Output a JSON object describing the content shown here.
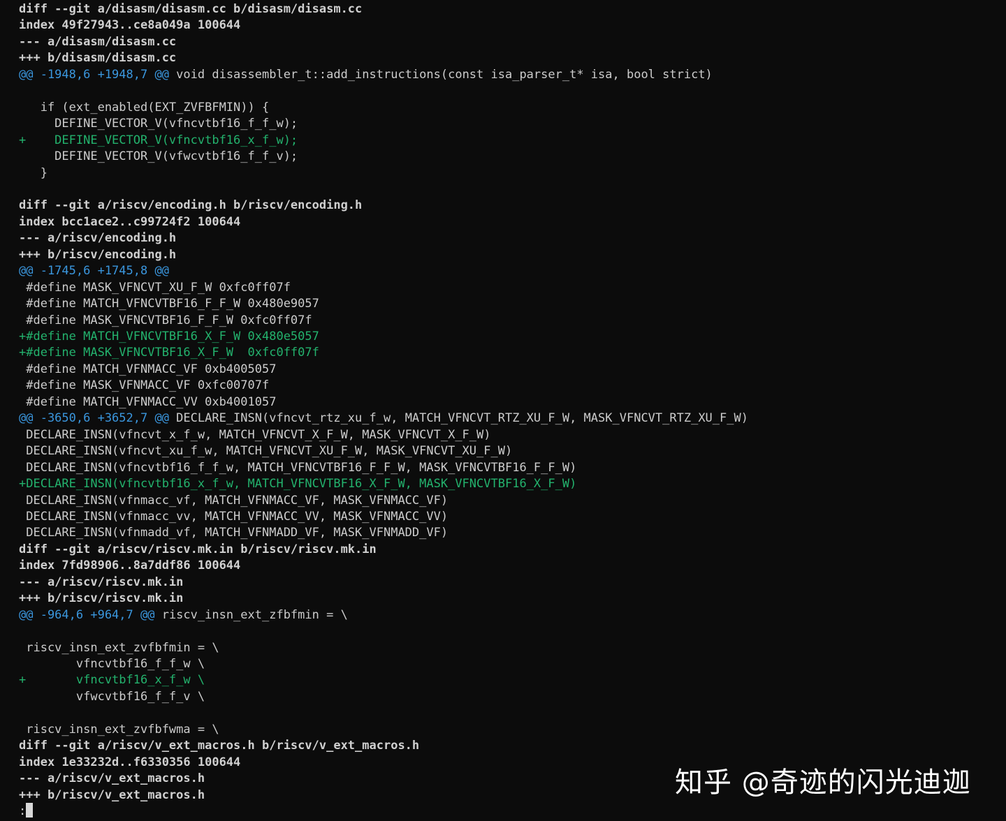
{
  "terminal": {
    "lines": [
      {
        "kind": "meta",
        "text": "diff --git a/disasm/disasm.cc b/disasm/disasm.cc"
      },
      {
        "kind": "meta",
        "text": "index 49f27943..ce8a049a 100644"
      },
      {
        "kind": "meta",
        "text": "--- a/disasm/disasm.cc"
      },
      {
        "kind": "meta",
        "text": "+++ b/disasm/disasm.cc"
      },
      {
        "kind": "hunk",
        "marker": "@@ -1948,6 +1948,7 @@",
        "text": " void disassembler_t::add_instructions(const isa_parser_t* isa, bool strict)"
      },
      {
        "kind": "ctx",
        "text": ""
      },
      {
        "kind": "ctx",
        "text": "   if (ext_enabled(EXT_ZVFBFMIN)) {"
      },
      {
        "kind": "ctx",
        "text": "     DEFINE_VECTOR_V(vfncvtbf16_f_f_w);"
      },
      {
        "kind": "add",
        "text": "+    DEFINE_VECTOR_V(vfncvtbf16_x_f_w);"
      },
      {
        "kind": "ctx",
        "text": "     DEFINE_VECTOR_V(vfwcvtbf16_f_f_v);"
      },
      {
        "kind": "ctx",
        "text": "   }"
      },
      {
        "kind": "ctx",
        "text": ""
      },
      {
        "kind": "meta",
        "text": "diff --git a/riscv/encoding.h b/riscv/encoding.h"
      },
      {
        "kind": "meta",
        "text": "index bcc1ace2..c99724f2 100644"
      },
      {
        "kind": "meta",
        "text": "--- a/riscv/encoding.h"
      },
      {
        "kind": "meta",
        "text": "+++ b/riscv/encoding.h"
      },
      {
        "kind": "hunk",
        "marker": "@@ -1745,6 +1745,8 @@",
        "text": ""
      },
      {
        "kind": "ctx",
        "text": " #define MASK_VFNCVT_XU_F_W 0xfc0ff07f"
      },
      {
        "kind": "ctx",
        "text": " #define MATCH_VFNCVTBF16_F_F_W 0x480e9057"
      },
      {
        "kind": "ctx",
        "text": " #define MASK_VFNCVTBF16_F_F_W 0xfc0ff07f"
      },
      {
        "kind": "add",
        "text": "+#define MATCH_VFNCVTBF16_X_F_W 0x480e5057"
      },
      {
        "kind": "add",
        "text": "+#define MASK_VFNCVTBF16_X_F_W  0xfc0ff07f"
      },
      {
        "kind": "ctx",
        "text": " #define MATCH_VFNMACC_VF 0xb4005057"
      },
      {
        "kind": "ctx",
        "text": " #define MASK_VFNMACC_VF 0xfc00707f"
      },
      {
        "kind": "ctx",
        "text": " #define MATCH_VFNMACC_VV 0xb4001057"
      },
      {
        "kind": "hunk",
        "marker": "@@ -3650,6 +3652,7 @@",
        "text": " DECLARE_INSN(vfncvt_rtz_xu_f_w, MATCH_VFNCVT_RTZ_XU_F_W, MASK_VFNCVT_RTZ_XU_F_W)"
      },
      {
        "kind": "ctx",
        "text": " DECLARE_INSN(vfncvt_x_f_w, MATCH_VFNCVT_X_F_W, MASK_VFNCVT_X_F_W)"
      },
      {
        "kind": "ctx",
        "text": " DECLARE_INSN(vfncvt_xu_f_w, MATCH_VFNCVT_XU_F_W, MASK_VFNCVT_XU_F_W)"
      },
      {
        "kind": "ctx",
        "text": " DECLARE_INSN(vfncvtbf16_f_f_w, MATCH_VFNCVTBF16_F_F_W, MASK_VFNCVTBF16_F_F_W)"
      },
      {
        "kind": "add",
        "text": "+DECLARE_INSN(vfncvtbf16_x_f_w, MATCH_VFNCVTBF16_X_F_W, MASK_VFNCVTBF16_X_F_W)"
      },
      {
        "kind": "ctx",
        "text": " DECLARE_INSN(vfnmacc_vf, MATCH_VFNMACC_VF, MASK_VFNMACC_VF)"
      },
      {
        "kind": "ctx",
        "text": " DECLARE_INSN(vfnmacc_vv, MATCH_VFNMACC_VV, MASK_VFNMACC_VV)"
      },
      {
        "kind": "ctx",
        "text": " DECLARE_INSN(vfnmadd_vf, MATCH_VFNMADD_VF, MASK_VFNMADD_VF)"
      },
      {
        "kind": "meta",
        "text": "diff --git a/riscv/riscv.mk.in b/riscv/riscv.mk.in"
      },
      {
        "kind": "meta",
        "text": "index 7fd98906..8a7ddf86 100644"
      },
      {
        "kind": "meta",
        "text": "--- a/riscv/riscv.mk.in"
      },
      {
        "kind": "meta",
        "text": "+++ b/riscv/riscv.mk.in"
      },
      {
        "kind": "hunk",
        "marker": "@@ -964,6 +964,7 @@",
        "text": " riscv_insn_ext_zfbfmin = \\"
      },
      {
        "kind": "ctx",
        "text": ""
      },
      {
        "kind": "ctx",
        "text": " riscv_insn_ext_zvfbfmin = \\"
      },
      {
        "kind": "ctx",
        "text": "        vfncvtbf16_f_f_w \\"
      },
      {
        "kind": "add",
        "text": "+       vfncvtbf16_x_f_w \\"
      },
      {
        "kind": "ctx",
        "text": "        vfwcvtbf16_f_f_v \\"
      },
      {
        "kind": "ctx",
        "text": ""
      },
      {
        "kind": "ctx",
        "text": " riscv_insn_ext_zvfbfwma = \\"
      },
      {
        "kind": "meta",
        "text": "diff --git a/riscv/v_ext_macros.h b/riscv/v_ext_macros.h"
      },
      {
        "kind": "meta",
        "text": "index 1e33232d..f6330356 100644"
      },
      {
        "kind": "meta",
        "text": "--- a/riscv/v_ext_macros.h"
      },
      {
        "kind": "meta",
        "text": "+++ b/riscv/v_ext_macros.h"
      },
      {
        "kind": "prompt",
        "text": ":"
      }
    ]
  },
  "watermark": {
    "text": "知乎 @奇迹的闪光迪迦"
  },
  "colors": {
    "background": "#0c0c0c",
    "text": "#cccccc",
    "added": "#23b26d",
    "hunk_marker": "#3a96dd"
  }
}
